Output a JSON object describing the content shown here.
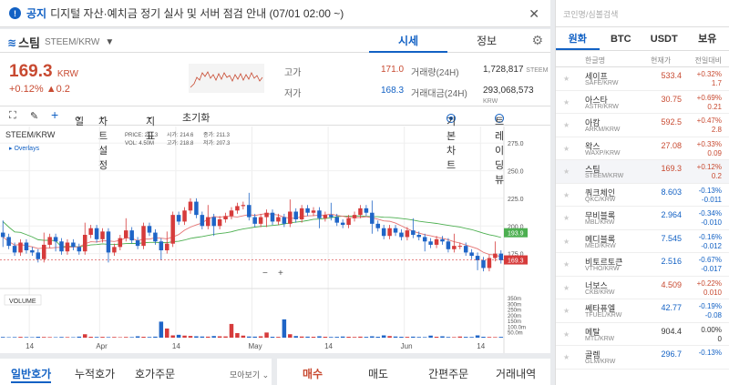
{
  "notice": {
    "label": "공지",
    "text": "디지털 자산·예치금 정기 실사 및 서버 점검 안내 (07/01 02:00 ~)"
  },
  "coin": {
    "name": "스팀",
    "pair": "STEEM/KRW",
    "tab_price": "시세",
    "tab_info": "정보"
  },
  "ticker": {
    "price": "169.3",
    "unit": "KRW",
    "change_pct": "+0.12%",
    "change_amt": "▲0.2"
  },
  "stats": {
    "high_label": "고가",
    "high": "171.0",
    "low_label": "저가",
    "low": "168.3",
    "vol_label": "거래량(24H)",
    "vol": "1,728,817",
    "vol_unit": "STEEM",
    "amt_label": "거래대금(24H)",
    "amt": "293,068,573",
    "amt_unit": "KRW"
  },
  "toolbar": {
    "period": "일",
    "settings": "차트설정",
    "indicator": "지표",
    "reset": "초기화",
    "basic": "기본차트",
    "tv": "트레이딩뷰"
  },
  "chart_data": {
    "type": "candlestick",
    "title": "STEEM/KRW",
    "overlays_label": "Overlays",
    "legend": {
      "price": "PRICE: 211.3",
      "open": "시가: 214.6",
      "close": "종가: 211.3",
      "vol": "VOL: 4.50M",
      "high": "고가: 218.8",
      "low": "저가: 207.3"
    },
    "price_ticks": [
      "275.0",
      "250.0",
      "225.0",
      "200.0",
      "175.0"
    ],
    "price_ticks_values": [
      275,
      250,
      225,
      200,
      175
    ],
    "ylim": [
      150,
      290
    ],
    "volume_label": "VOLUME",
    "volume_ticks": [
      "350m",
      "300m",
      "250m",
      "200m",
      "150m",
      "100.0m",
      "50.0m"
    ],
    "volume_ticks_values": [
      350,
      300,
      250,
      200,
      150,
      100,
      50
    ],
    "x_ticks": [
      "14",
      "Apr",
      "14",
      "May",
      "14",
      "Jun",
      "14"
    ],
    "x_ticks_pos": [
      5,
      17,
      30,
      43,
      56,
      69,
      82
    ],
    "ma_green_last": "193.9",
    "current_price": "169.3",
    "closes": [
      190,
      182,
      176,
      185,
      178,
      176,
      170,
      183,
      190,
      186,
      177,
      185,
      181,
      177,
      192,
      198,
      188,
      195,
      176,
      181,
      189,
      196,
      187,
      182,
      200,
      194,
      186,
      178,
      184,
      210,
      204,
      214,
      222,
      210,
      200,
      208,
      200,
      206,
      209,
      214,
      218,
      219,
      208,
      202,
      208,
      212,
      204,
      208,
      202,
      213,
      206,
      216,
      212,
      214,
      207,
      210,
      208,
      203,
      201,
      207,
      210,
      216,
      212,
      202,
      198,
      191,
      198,
      194,
      190,
      196,
      192,
      190,
      186,
      183,
      188,
      186,
      179,
      182,
      182,
      176,
      173,
      169,
      162,
      171,
      175,
      169
    ],
    "volumes": [
      6,
      4,
      5,
      7,
      5,
      4,
      8,
      6,
      5,
      4,
      6,
      5,
      4,
      9,
      30,
      8,
      6,
      7,
      5,
      6,
      4,
      6,
      5,
      12,
      8,
      6,
      9,
      140,
      80,
      20,
      25,
      18,
      15,
      12,
      10,
      9,
      14,
      12,
      11,
      120,
      40,
      18,
      10,
      9,
      12,
      45,
      8,
      7,
      160,
      30,
      14,
      10,
      9,
      8,
      12,
      8,
      6,
      7,
      10,
      8,
      6,
      9,
      7,
      12,
      8,
      20,
      14,
      10,
      8,
      7,
      9,
      6,
      5,
      18,
      8,
      12,
      6,
      5,
      10,
      7,
      6,
      20,
      8,
      6,
      5,
      7
    ]
  },
  "zoom": {
    "minus": "−",
    "plus": "+"
  },
  "bottom": {
    "tab1": "일반호가",
    "tab2": "누적호가",
    "tab3": "호가주문",
    "more": "모아보기",
    "buy": "매수",
    "sell": "매도",
    "simple": "간편주문",
    "history": "거래내역"
  },
  "market": {
    "search_placeholder": "코인명/심볼검색",
    "tabs": [
      "원화",
      "BTC",
      "USDT",
      "보유"
    ],
    "head_name": "한글명",
    "head_price": "현재가",
    "head_change": "전일대비",
    "rows": [
      {
        "name": "세이프",
        "sym": "SAFE/KRW",
        "price": "533.4",
        "pct": "+0.32%",
        "amt": "1.7",
        "dir": "up"
      },
      {
        "name": "아스타",
        "sym": "ASTR/KRW",
        "price": "30.75",
        "pct": "+0.69%",
        "amt": "0.21",
        "dir": "up"
      },
      {
        "name": "아캄",
        "sym": "ARKM/KRW",
        "price": "592.5",
        "pct": "+0.47%",
        "amt": "2.8",
        "dir": "up"
      },
      {
        "name": "왁스",
        "sym": "WAXP/KRW",
        "price": "27.08",
        "pct": "+0.33%",
        "amt": "0.09",
        "dir": "up"
      },
      {
        "name": "스팀",
        "sym": "STEEM/KRW",
        "price": "169.3",
        "pct": "+0.12%",
        "amt": "0.2",
        "dir": "up",
        "sel": true
      },
      {
        "name": "쿼크체인",
        "sym": "QKC/KRW",
        "price": "8.603",
        "pct": "-0.13%",
        "amt": "-0.011",
        "dir": "down"
      },
      {
        "name": "무비블록",
        "sym": "MBL/KRW",
        "price": "2.964",
        "pct": "-0.34%",
        "amt": "-0.010",
        "dir": "down"
      },
      {
        "name": "메디블록",
        "sym": "MED/KRW",
        "price": "7.545",
        "pct": "-0.16%",
        "amt": "-0.012",
        "dir": "down"
      },
      {
        "name": "비토르토큰",
        "sym": "VTHO/KRW",
        "price": "2.516",
        "pct": "-0.67%",
        "amt": "-0.017",
        "dir": "down"
      },
      {
        "name": "너보스",
        "sym": "CKB/KRW",
        "price": "4.509",
        "pct": "+0.22%",
        "amt": "0.010",
        "dir": "up"
      },
      {
        "name": "쎄타퓨엘",
        "sym": "TFUEL/KRW",
        "price": "42.77",
        "pct": "-0.19%",
        "amt": "-0.08",
        "dir": "down"
      },
      {
        "name": "메탈",
        "sym": "MTL/KRW",
        "price": "904.4",
        "pct": "0.00%",
        "amt": "0",
        "dir": "flat"
      },
      {
        "name": "골렘",
        "sym": "GLM/KRW",
        "price": "296.7",
        "pct": "-0.13%",
        "amt": "",
        "dir": "down"
      }
    ]
  }
}
